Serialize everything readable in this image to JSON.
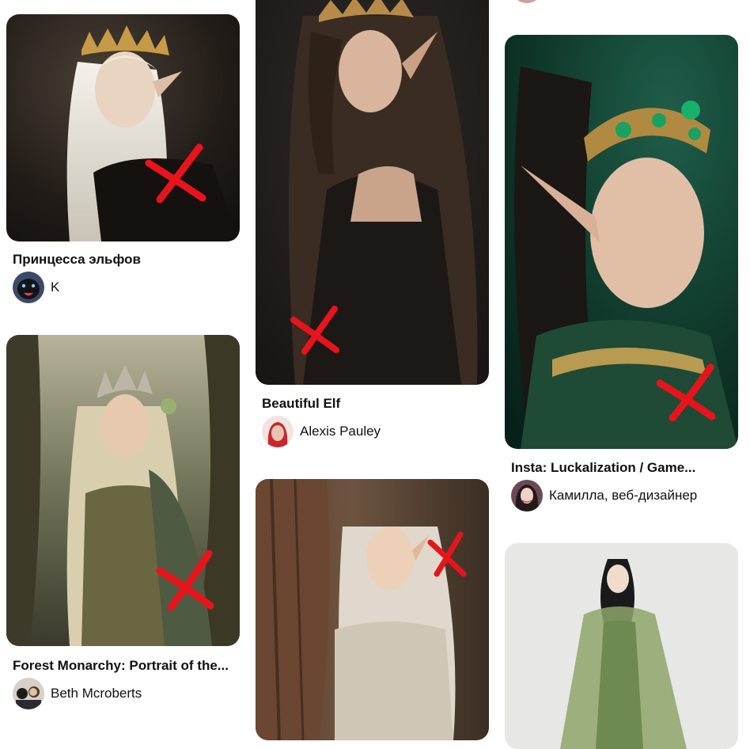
{
  "pins": [
    {
      "id": "pin1",
      "title": "Принцесса эльфов",
      "author": "K",
      "image_alt": "elf princess with white hair and golden crown",
      "avatar_icon": "panther-avatar-icon",
      "accent": "#2a2420"
    },
    {
      "id": "pin2",
      "title": "Beautiful Elf",
      "author": "Alexis Pauley",
      "image_alt": "elf with long dark curly hair and tiara",
      "avatar_icon": "red-hood-avatar-icon",
      "accent": "#1e1a18"
    },
    {
      "id": "pin3",
      "title": "Insta: Luckalization / Game...",
      "author": "Камилла, веб-дизайнер",
      "image_alt": "elf with emerald crown and green dress",
      "avatar_icon": "portrait-avatar-icon",
      "accent": "#0f3a2c"
    },
    {
      "id": "pin4",
      "title": "Forest Monarchy: Portrait of the...",
      "author": "Beth Mcroberts",
      "image_alt": "forest elf queen with silver crown",
      "avatar_icon": "group-avatar-icon",
      "accent": "#4a5440"
    },
    {
      "id": "pin5",
      "title": "",
      "author": "",
      "image_alt": "elf girl leaning on tree in forest",
      "avatar_icon": "",
      "accent": "#5a4030"
    },
    {
      "id": "pin6",
      "title": "",
      "author": "",
      "image_alt": "elf in green cape on light background",
      "avatar_icon": "",
      "accent": "#e7e7e5"
    }
  ],
  "colors": {
    "cross_mark": "#e8141c",
    "text": "#111111"
  }
}
